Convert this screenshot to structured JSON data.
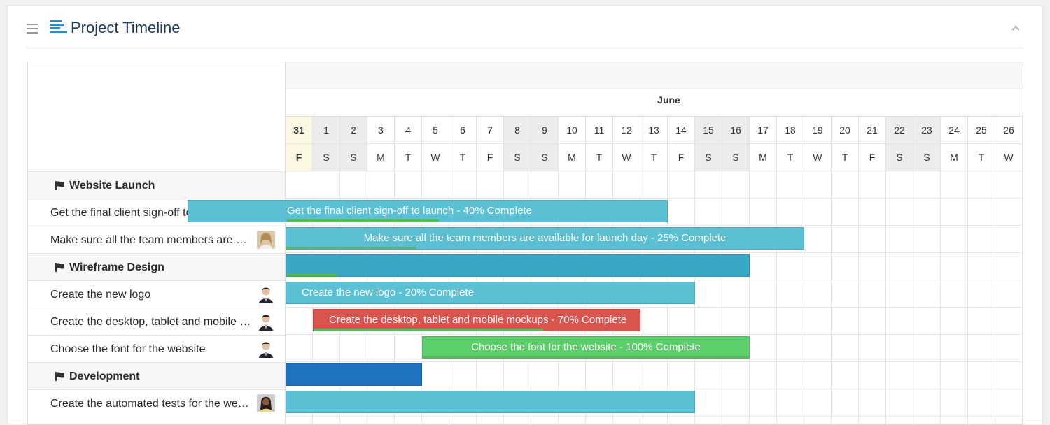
{
  "header": {
    "title": "Project Timeline"
  },
  "timeline": {
    "month": "June",
    "days": [
      {
        "d": "31",
        "w": "F",
        "type": "today"
      },
      {
        "d": "1",
        "w": "S",
        "type": "weekend"
      },
      {
        "d": "2",
        "w": "S",
        "type": "weekend"
      },
      {
        "d": "3",
        "w": "M",
        "type": ""
      },
      {
        "d": "4",
        "w": "T",
        "type": ""
      },
      {
        "d": "5",
        "w": "W",
        "type": ""
      },
      {
        "d": "6",
        "w": "T",
        "type": ""
      },
      {
        "d": "7",
        "w": "F",
        "type": ""
      },
      {
        "d": "8",
        "w": "S",
        "type": "weekend"
      },
      {
        "d": "9",
        "w": "S",
        "type": "weekend"
      },
      {
        "d": "10",
        "w": "M",
        "type": ""
      },
      {
        "d": "11",
        "w": "T",
        "type": ""
      },
      {
        "d": "12",
        "w": "W",
        "type": ""
      },
      {
        "d": "13",
        "w": "T",
        "type": ""
      },
      {
        "d": "14",
        "w": "F",
        "type": ""
      },
      {
        "d": "15",
        "w": "S",
        "type": "weekend"
      },
      {
        "d": "16",
        "w": "S",
        "type": "weekend"
      },
      {
        "d": "17",
        "w": "M",
        "type": ""
      },
      {
        "d": "18",
        "w": "T",
        "type": ""
      },
      {
        "d": "19",
        "w": "W",
        "type": ""
      },
      {
        "d": "20",
        "w": "T",
        "type": ""
      },
      {
        "d": "21",
        "w": "F",
        "type": ""
      },
      {
        "d": "22",
        "w": "S",
        "type": "weekend"
      },
      {
        "d": "23",
        "w": "S",
        "type": "weekend"
      },
      {
        "d": "24",
        "w": "M",
        "type": ""
      },
      {
        "d": "25",
        "w": "T",
        "type": ""
      },
      {
        "d": "26",
        "w": "W",
        "type": ""
      }
    ]
  },
  "rows": [
    {
      "kind": "group",
      "label": "Website Launch"
    },
    {
      "kind": "task",
      "label": "Get the final client sign-off to launch",
      "avatar": "woman-avatar"
    },
    {
      "kind": "task",
      "label": "Make sure all the team members are available for launch day",
      "avatar": "woman-avatar"
    },
    {
      "kind": "group",
      "label": "Wireframe Design"
    },
    {
      "kind": "task",
      "label": "Create the new logo",
      "avatar": "man-avatar"
    },
    {
      "kind": "task",
      "label": "Create the desktop, tablet and mobile mockups",
      "avatar": "man-avatar"
    },
    {
      "kind": "task",
      "label": "Choose the font for the website",
      "avatar": "man-avatar"
    },
    {
      "kind": "group",
      "label": "Development"
    },
    {
      "kind": "task",
      "label": "Create the automated tests for the website",
      "avatar": "woman2-avatar"
    }
  ],
  "bars": [
    {
      "row": 1,
      "start": -3.6,
      "end": 14,
      "label": "Get the final client sign-off to launch - 40% Complete",
      "color": "#5bc0d3",
      "progress": 0.4
    },
    {
      "row": 2,
      "start": 0,
      "end": 19,
      "label": "Make sure all the team members are available for launch day - 25% Complete",
      "color": "#5bc0d3",
      "progress": 0.25,
      "center": true
    },
    {
      "row": 3,
      "start": 0,
      "end": 17,
      "label": "",
      "color": "#39a8c6",
      "progress": 0.11
    },
    {
      "row": 4,
      "start": 0,
      "end": 15,
      "label": "Create the new logo - 20% Complete",
      "color": "#5bc0d3",
      "progress": 0.0
    },
    {
      "row": 5,
      "start": 1,
      "end": 13,
      "label": "Create the desktop, tablet and mobile mockups - 70% Complete",
      "color": "#d9534f",
      "progress": 0.7
    },
    {
      "row": 6,
      "start": 5,
      "end": 17,
      "label": "Choose the font for the website - 100% Complete",
      "color": "#5cce6a",
      "progress": 1.0,
      "center": true
    },
    {
      "row": 7,
      "start": 0,
      "end": 5,
      "label": "",
      "color": "#1e73be",
      "progress": 0.0
    },
    {
      "row": 8,
      "start": 0,
      "end": 15,
      "label": "",
      "color": "#5bc0d3",
      "progress": 0.0
    }
  ],
  "colors": {
    "accent": "#2a8fcf",
    "title": "#1f3a58",
    "progress": "#5cb85c"
  }
}
